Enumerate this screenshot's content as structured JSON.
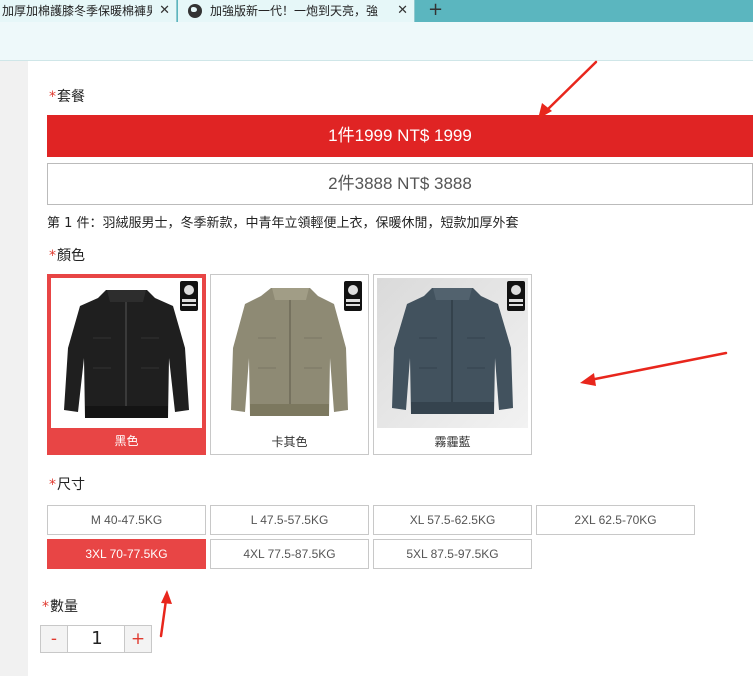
{
  "browser": {
    "tabs": [
      {
        "title": "加厚加棉護膝冬季保暖棉褲男",
        "close": "✕"
      },
      {
        "title": "加強版新一代！一炮到天亮，強",
        "close": "✕"
      }
    ],
    "new_tab": "+"
  },
  "package": {
    "label": "套餐",
    "options": [
      {
        "label": "1件1999 NT$ 1999",
        "selected": true
      },
      {
        "label": "2件3888 NT$ 3888",
        "selected": false
      }
    ],
    "description": "第 1 件：羽絨服男士，冬季新款，中青年立領輕便上衣，保暖休閒，短款加厚外套"
  },
  "color": {
    "label": "顏色",
    "options": [
      {
        "label": "黑色",
        "selected": true,
        "jacket": "#222222"
      },
      {
        "label": "卡其色",
        "selected": false,
        "jacket": "#8e8a74"
      },
      {
        "label": "霧霾藍",
        "selected": false,
        "jacket": "#42525e"
      }
    ]
  },
  "size": {
    "label": "尺寸",
    "options": [
      {
        "label": "M 40-47.5KG",
        "selected": false
      },
      {
        "label": "L 47.5-57.5KG",
        "selected": false
      },
      {
        "label": "XL 57.5-62.5KG",
        "selected": false
      },
      {
        "label": "2XL 62.5-70KG",
        "selected": false
      },
      {
        "label": "3XL 70-77.5KG",
        "selected": true
      },
      {
        "label": "4XL 77.5-87.5KG",
        "selected": false
      },
      {
        "label": "5XL 87.5-97.5KG",
        "selected": false
      }
    ]
  },
  "quantity": {
    "label": "數量",
    "minus": "-",
    "value": "1",
    "plus": "+"
  },
  "required_mark": "*",
  "colors": {
    "accent": "#e02424",
    "selected": "#e84545",
    "annotation_arrow": "#e8261c",
    "tabbar": "#5bb6bf"
  }
}
